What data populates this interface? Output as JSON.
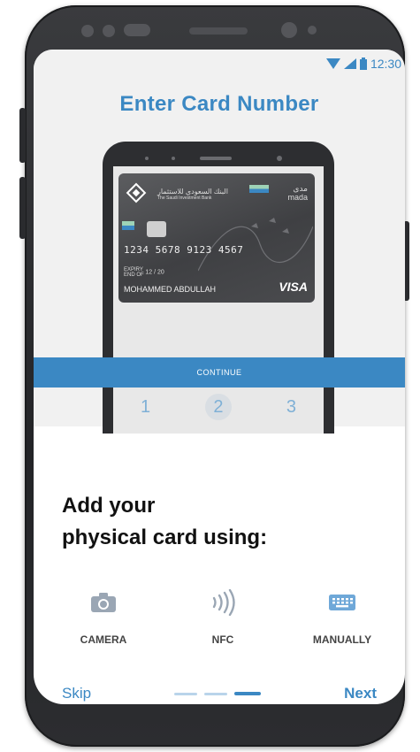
{
  "status_bar": {
    "time": "12:30",
    "icons": [
      "wifi-icon",
      "signal-icon",
      "battery-icon"
    ]
  },
  "illustration": {
    "title": "Enter Card Number",
    "card": {
      "bank_name_ar": "البنك السعودي للاستثمار",
      "bank_name_en": "The Saudi Investment Bank",
      "network_ar": "مدى",
      "network_en": "mada",
      "number": "1234 5678 9123 4567",
      "expiry_label": "EXPIRY\nEND OF",
      "expiry": "12 / 20",
      "holder": "MOHAMMED ABDULLAH",
      "brand": "VISA"
    },
    "continue_label": "CONTINUE",
    "keypad": [
      "1",
      "2",
      "3"
    ]
  },
  "onboarding": {
    "heading_line1": "Add your",
    "heading_line2": "physical card using:",
    "options": [
      {
        "label": "CAMERA",
        "icon": "camera-icon"
      },
      {
        "label": "NFC",
        "icon": "nfc-icon"
      },
      {
        "label": "MANUALLY",
        "icon": "keyboard-icon"
      }
    ],
    "skip_label": "Skip",
    "next_label": "Next",
    "page_index": 3,
    "page_count": 3
  },
  "colors": {
    "accent": "#3b88c3",
    "text_dark": "#111111",
    "icon_gray": "#9aa6b4"
  }
}
